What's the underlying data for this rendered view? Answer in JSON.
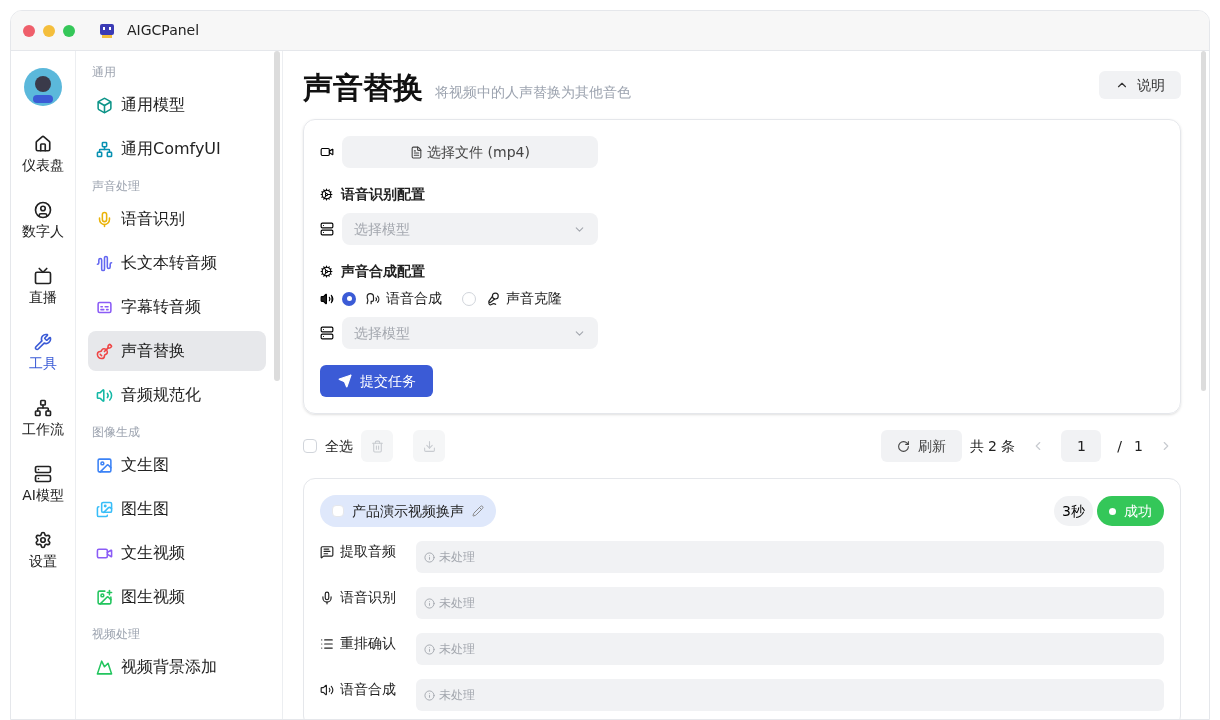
{
  "window": {
    "title": "AIGCPanel"
  },
  "rail": [
    {
      "label": "仪表盘",
      "selected": false
    },
    {
      "label": "数字人",
      "selected": false
    },
    {
      "label": "直播",
      "selected": false
    },
    {
      "label": "工具",
      "selected": true
    },
    {
      "label": "工作流",
      "selected": false
    },
    {
      "label": "AI模型",
      "selected": false
    },
    {
      "label": "设置",
      "selected": false
    }
  ],
  "sidebar": {
    "groups": [
      {
        "title": "通用",
        "items": [
          {
            "label": "通用模型",
            "selected": false
          },
          {
            "label": "通用ComfyUI",
            "selected": false
          }
        ]
      },
      {
        "title": "声音处理",
        "items": [
          {
            "label": "语音识别",
            "selected": false
          },
          {
            "label": "长文本转音频",
            "selected": false
          },
          {
            "label": "字幕转音频",
            "selected": false
          },
          {
            "label": "声音替换",
            "selected": true
          },
          {
            "label": "音频规范化",
            "selected": false
          }
        ]
      },
      {
        "title": "图像生成",
        "items": [
          {
            "label": "文生图",
            "selected": false
          },
          {
            "label": "图生图",
            "selected": false
          },
          {
            "label": "文生视频",
            "selected": false
          },
          {
            "label": "图生视频",
            "selected": false
          }
        ]
      },
      {
        "title": "视频处理",
        "items": [
          {
            "label": "视频背景添加",
            "selected": false
          }
        ]
      }
    ]
  },
  "page": {
    "title": "声音替换",
    "subtitle": "将视频中的人声替换为其他音色",
    "help_button": "说明"
  },
  "form": {
    "file_button": "选择文件 (mp4)",
    "asr_heading": "语音识别配置",
    "asr_model": {
      "placeholder": "选择模型"
    },
    "tts_heading": "声音合成配置",
    "tts_modes": [
      {
        "label": "语音合成",
        "selected": true
      },
      {
        "label": "声音克隆",
        "selected": false
      }
    ],
    "tts_model": {
      "placeholder": "选择模型"
    },
    "submit": "提交任务"
  },
  "toolbar": {
    "select_all": {
      "label": "全选",
      "checked": false
    },
    "refresh": "刷新",
    "total": "共 2 条",
    "page": "1",
    "page_sep": "/",
    "page_count": "1"
  },
  "tasks": [
    {
      "title": "产品演示视频换声",
      "checked": false,
      "duration": "3秒",
      "status": {
        "label": "成功",
        "kind": "success"
      },
      "steps": [
        {
          "label": "提取音频",
          "value": "未处理"
        },
        {
          "label": "语音识别",
          "value": "未处理"
        },
        {
          "label": "重排确认",
          "value": "未处理"
        },
        {
          "label": "语音合成",
          "value": "未处理"
        }
      ]
    }
  ]
}
